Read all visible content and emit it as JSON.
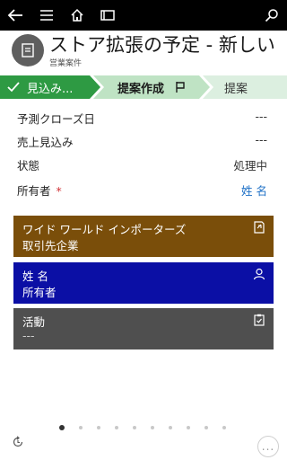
{
  "nav": {
    "back_icon": "back-arrow-icon",
    "menu_icon": "hamburger-icon",
    "home_icon": "home-icon",
    "record_icon": "card-icon",
    "search_icon": "search-icon"
  },
  "record": {
    "title": "ストア拡張の予定 - 新しい",
    "entity": "営業案件",
    "avatar_icon": "document-icon"
  },
  "stages": [
    {
      "label": "見込み...",
      "state": "completed",
      "icon": "check-icon"
    },
    {
      "label": "提案作成",
      "state": "active",
      "icon": "flag-icon"
    },
    {
      "label": "提案",
      "state": "upcoming"
    }
  ],
  "fields": [
    {
      "label": "予測クローズ日",
      "value": "---"
    },
    {
      "label": "売上見込み",
      "value": "---"
    },
    {
      "label": "状態",
      "value": "処理中"
    },
    {
      "label": "所有者",
      "required_mark": "*",
      "value": "姓 名"
    }
  ],
  "cards": {
    "account": {
      "title": "ワイド ワールド インポーターズ",
      "subtitle": "取引先企業",
      "icon": "account-icon",
      "color": "#7a4e0a"
    },
    "owner": {
      "title": "姓 名",
      "subtitle": "所有者",
      "icon": "person-icon",
      "color": "#0b0fa5"
    },
    "activity": {
      "title": "活動",
      "subtitle": "---",
      "icon": "clipboard-icon",
      "color": "#4f4f4f"
    }
  },
  "pager": {
    "total": 10,
    "active_index": 0
  },
  "footer": {
    "left_icon": "refresh-icon",
    "more_label": "..."
  }
}
